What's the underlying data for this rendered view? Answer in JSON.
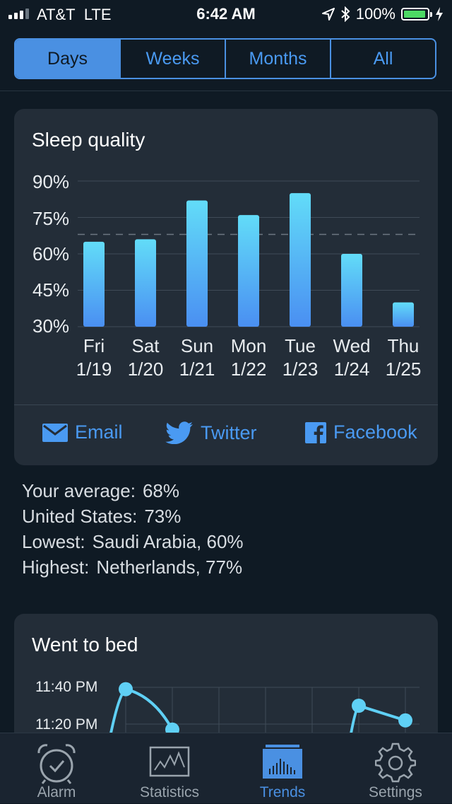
{
  "status_bar": {
    "carrier": "AT&T",
    "network": "LTE",
    "time": "6:42 AM",
    "battery": "100%",
    "battery_level": 1.0,
    "signal_bars": 3
  },
  "segments": [
    {
      "label": "Days",
      "active": true
    },
    {
      "label": "Weeks",
      "active": false
    },
    {
      "label": "Months",
      "active": false
    },
    {
      "label": "All",
      "active": false
    }
  ],
  "sleep_card": {
    "title": "Sleep quality",
    "share": {
      "email": "Email",
      "twitter": "Twitter",
      "facebook": "Facebook"
    }
  },
  "chart_data": [
    {
      "type": "bar",
      "title": "Sleep quality",
      "categories": [
        "Fri 1/19",
        "Sat 1/20",
        "Sun 1/21",
        "Mon 1/22",
        "Tue 1/23",
        "Wed 1/24",
        "Thu 1/25"
      ],
      "category_lines": [
        [
          "Fri",
          "1/19"
        ],
        [
          "Sat",
          "1/20"
        ],
        [
          "Sun",
          "1/21"
        ],
        [
          "Mon",
          "1/22"
        ],
        [
          "Tue",
          "1/23"
        ],
        [
          "Wed",
          "1/24"
        ],
        [
          "Thu",
          "1/25"
        ]
      ],
      "values": [
        65,
        66,
        82,
        76,
        85,
        60,
        40
      ],
      "yticks": [
        "90%",
        "75%",
        "60%",
        "45%",
        "30%"
      ],
      "ylim": [
        30,
        90
      ],
      "reference_line": 68,
      "grid": true,
      "colors": {
        "bar_top": "#62dcf8",
        "bar_bottom": "#4a8ff2"
      }
    },
    {
      "type": "line",
      "title": "Went to bed",
      "yticks": [
        "11:40 PM",
        "11:20 PM"
      ],
      "visible_points": [
        {
          "x": 2,
          "y": "11:39 PM"
        },
        {
          "x": 3,
          "y": "11:17 PM"
        },
        {
          "x": 7,
          "y": "11:30 PM"
        },
        {
          "x": 8,
          "y": "11:22 PM"
        }
      ],
      "color": "#5fd0f5"
    }
  ],
  "stats": [
    {
      "label": "Your average:",
      "value": "68%"
    },
    {
      "label": "United States:",
      "value": "73%"
    },
    {
      "label": "Lowest:",
      "value": "Saudi Arabia, 60%"
    },
    {
      "label": "Highest:",
      "value": "Netherlands, 77%"
    }
  ],
  "bed_card": {
    "title": "Went to bed"
  },
  "tab_bar": [
    {
      "label": "Alarm",
      "icon": "alarm-clock-icon",
      "active": false
    },
    {
      "label": "Statistics",
      "icon": "statistics-chart-icon",
      "active": false
    },
    {
      "label": "Trends",
      "icon": "trends-bars-icon",
      "active": true
    },
    {
      "label": "Settings",
      "icon": "gear-icon",
      "active": false
    }
  ],
  "colors": {
    "accent": "#4a90e2",
    "background": "#0f1a24",
    "card": "#232d38"
  }
}
